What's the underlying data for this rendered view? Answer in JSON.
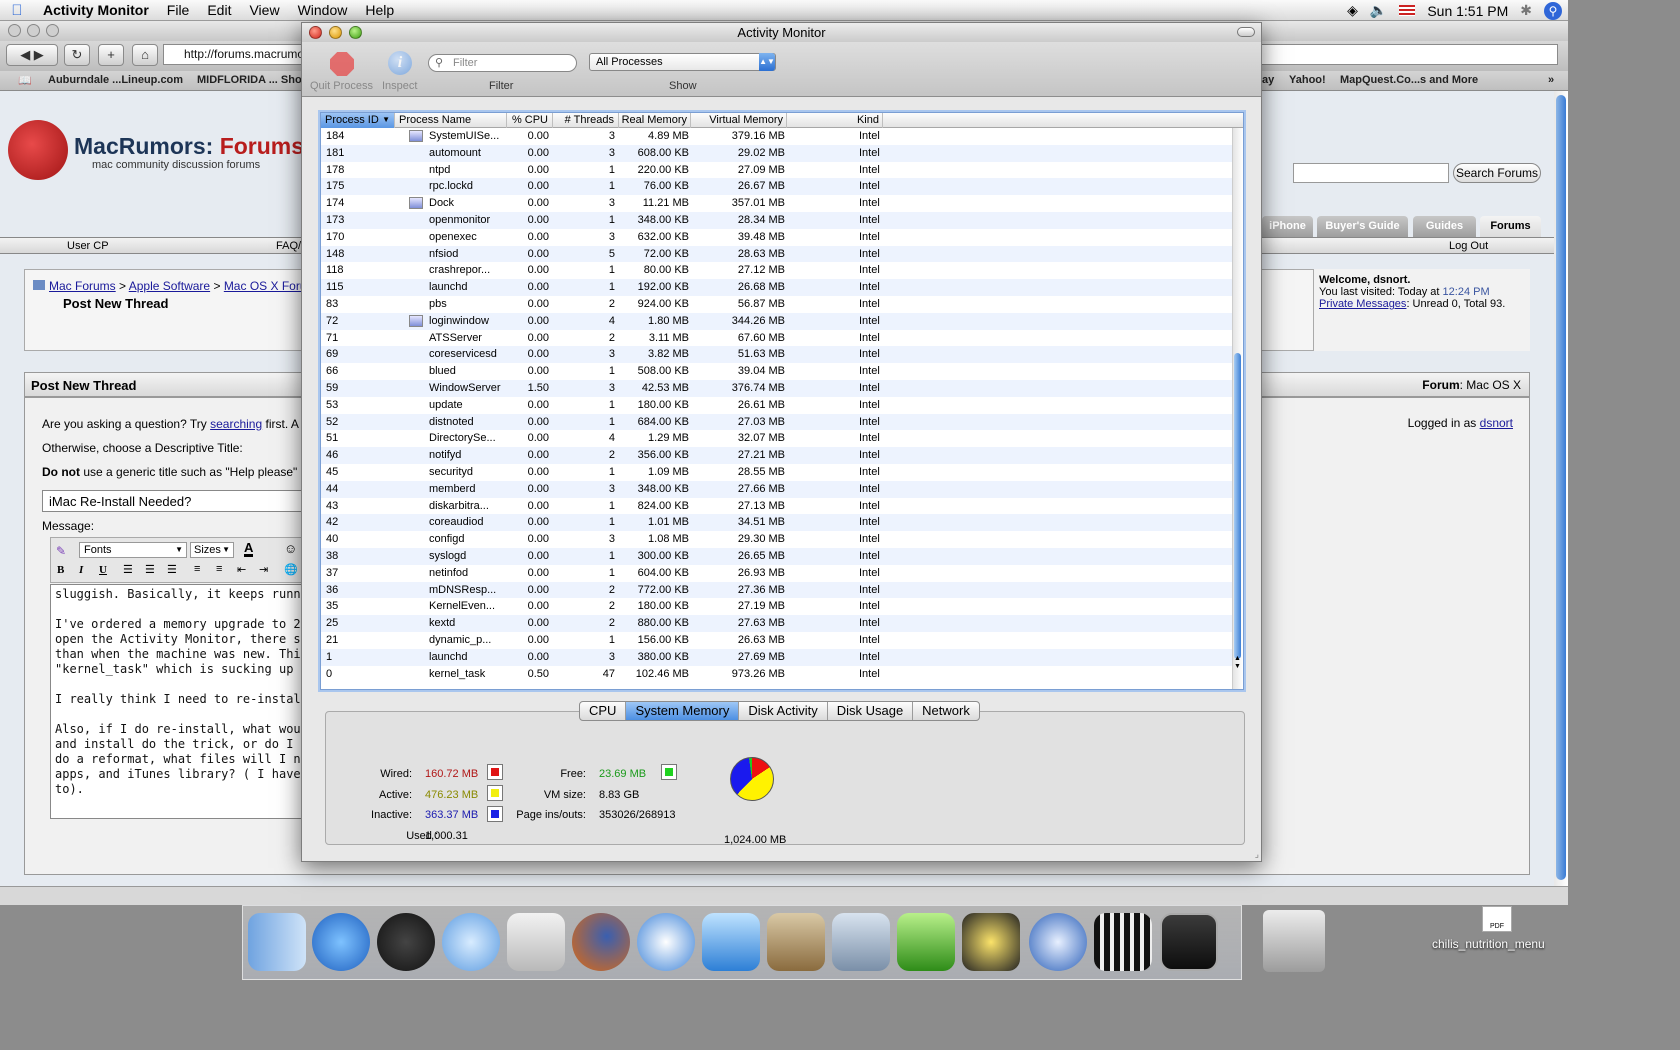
{
  "menubar": {
    "app": "Activity Monitor",
    "items": [
      "File",
      "Edit",
      "View",
      "Window",
      "Help"
    ],
    "clock": "Sun 1:51 PM"
  },
  "browser": {
    "url": "http://forums.macrumors.com/newthread.php?do=newthread&f=72",
    "bookmarks_left": [
      "Auburndale ...Lineup.com",
      "MIDFLORIDA ... Sho"
    ],
    "bookmarks_right": [
      "ay",
      "Yahoo!",
      "MapQuest.Co...s and More"
    ]
  },
  "forum": {
    "logo_main": "MacRumors:",
    "logo_forums": "Forums",
    "logo_sub": "mac community discussion forums",
    "search_button": "Search Forums",
    "tabs": [
      "iPhone",
      "Buyer's Guide",
      "Guides",
      "Forums"
    ],
    "nav_left": "User CP",
    "nav_mid": "FAQ/",
    "nav_right": "Log Out",
    "crumbs": [
      "Mac Forums",
      "Apple Software",
      "Mac OS X Foru"
    ],
    "crumb_sep": ">",
    "page_title": "Post New Thread",
    "welcome_title": "Welcome, dsnort.",
    "last_visited_prefix": "You last visited: Today at",
    "last_visited_time": "12:24 PM",
    "pm_link": "Private Messages",
    "pm_text": ": Unread 0, Total 93.",
    "post_bar_title": "Post New Thread",
    "forum_label": "Forum",
    "forum_name": ": Mac OS X",
    "logged_in_prefix": "Logged in as",
    "logged_in_user": "dsnort",
    "ask_prefix": "Are you asking a question? Try",
    "ask_link": "searching",
    "ask_suffix": "first. A",
    "otherwise": "Otherwise, choose a Descriptive Title:",
    "donot_bold": "Do not",
    "donot_rest": "use a generic title such as \"Help please\"",
    "title_value": "iMac Re-Install Needed?",
    "message_label": "Message:",
    "font_select": "Fonts",
    "size_select": "Sizes",
    "message_text": "sluggish. Basically, it keeps running ou\n\nI've ordered a memory upgrade to 2 GB\nopen the Activity Monitor, there seems\nthan when the machine was new. This i\n\"kernel_task\" which is sucking up 10%\n\nI really think I need to re-install the OS\n\nAlso, if I do re-install, what would be th\nand install do the trick, or do I need to\ndo a reformat, what files will I need to\napps, and iTunes library? ( I have a 500\nto)."
  },
  "am": {
    "title": "Activity Monitor",
    "quit_label": "Quit Process",
    "inspect_label": "Inspect",
    "filter_placeholder": "Filter",
    "filter_label": "Filter",
    "show_value": "All Processes",
    "show_label": "Show",
    "columns": [
      "Process ID",
      "Process Name",
      "% CPU",
      "# Threads",
      "Real Memory",
      "Virtual Memory",
      "Kind"
    ],
    "sort_column": "Process ID",
    "rows": [
      {
        "pid": "184",
        "name": "SystemUISe...",
        "cpu": "0.00",
        "threads": "3",
        "real": "4.89 MB",
        "virtual": "379.16 MB",
        "kind": "Intel",
        "icon": "system-ui-server-icon"
      },
      {
        "pid": "181",
        "name": "automount",
        "cpu": "0.00",
        "threads": "3",
        "real": "608.00 KB",
        "virtual": "29.02 MB",
        "kind": "Intel"
      },
      {
        "pid": "178",
        "name": "ntpd",
        "cpu": "0.00",
        "threads": "1",
        "real": "220.00 KB",
        "virtual": "27.09 MB",
        "kind": "Intel"
      },
      {
        "pid": "175",
        "name": "rpc.lockd",
        "cpu": "0.00",
        "threads": "1",
        "real": "76.00 KB",
        "virtual": "26.67 MB",
        "kind": "Intel"
      },
      {
        "pid": "174",
        "name": "Dock",
        "cpu": "0.00",
        "threads": "3",
        "real": "11.21 MB",
        "virtual": "357.01 MB",
        "kind": "Intel",
        "icon": "dock-app-icon"
      },
      {
        "pid": "173",
        "name": "openmonitor",
        "cpu": "0.00",
        "threads": "1",
        "real": "348.00 KB",
        "virtual": "28.34 MB",
        "kind": "Intel"
      },
      {
        "pid": "170",
        "name": "openexec",
        "cpu": "0.00",
        "threads": "3",
        "real": "632.00 KB",
        "virtual": "39.48 MB",
        "kind": "Intel"
      },
      {
        "pid": "148",
        "name": "nfsiod",
        "cpu": "0.00",
        "threads": "5",
        "real": "72.00 KB",
        "virtual": "28.63 MB",
        "kind": "Intel"
      },
      {
        "pid": "118",
        "name": "crashrepor...",
        "cpu": "0.00",
        "threads": "1",
        "real": "80.00 KB",
        "virtual": "27.12 MB",
        "kind": "Intel"
      },
      {
        "pid": "115",
        "name": "launchd",
        "cpu": "0.00",
        "threads": "1",
        "real": "192.00 KB",
        "virtual": "26.68 MB",
        "kind": "Intel"
      },
      {
        "pid": "83",
        "name": "pbs",
        "cpu": "0.00",
        "threads": "2",
        "real": "924.00 KB",
        "virtual": "56.87 MB",
        "kind": "Intel"
      },
      {
        "pid": "72",
        "name": "loginwindow",
        "cpu": "0.00",
        "threads": "4",
        "real": "1.80 MB",
        "virtual": "344.26 MB",
        "kind": "Intel",
        "icon": "loginwindow-icon"
      },
      {
        "pid": "71",
        "name": "ATSServer",
        "cpu": "0.00",
        "threads": "2",
        "real": "3.11 MB",
        "virtual": "67.60 MB",
        "kind": "Intel"
      },
      {
        "pid": "69",
        "name": "coreservicesd",
        "cpu": "0.00",
        "threads": "3",
        "real": "3.82 MB",
        "virtual": "51.63 MB",
        "kind": "Intel"
      },
      {
        "pid": "66",
        "name": "blued",
        "cpu": "0.00",
        "threads": "1",
        "real": "508.00 KB",
        "virtual": "39.04 MB",
        "kind": "Intel"
      },
      {
        "pid": "59",
        "name": "WindowServer",
        "cpu": "1.50",
        "threads": "3",
        "real": "42.53 MB",
        "virtual": "376.74 MB",
        "kind": "Intel"
      },
      {
        "pid": "53",
        "name": "update",
        "cpu": "0.00",
        "threads": "1",
        "real": "180.00 KB",
        "virtual": "26.61 MB",
        "kind": "Intel"
      },
      {
        "pid": "52",
        "name": "distnoted",
        "cpu": "0.00",
        "threads": "1",
        "real": "684.00 KB",
        "virtual": "27.03 MB",
        "kind": "Intel"
      },
      {
        "pid": "51",
        "name": "DirectorySe...",
        "cpu": "0.00",
        "threads": "4",
        "real": "1.29 MB",
        "virtual": "32.07 MB",
        "kind": "Intel"
      },
      {
        "pid": "46",
        "name": "notifyd",
        "cpu": "0.00",
        "threads": "2",
        "real": "356.00 KB",
        "virtual": "27.21 MB",
        "kind": "Intel"
      },
      {
        "pid": "45",
        "name": "securityd",
        "cpu": "0.00",
        "threads": "1",
        "real": "1.09 MB",
        "virtual": "28.55 MB",
        "kind": "Intel"
      },
      {
        "pid": "44",
        "name": "memberd",
        "cpu": "0.00",
        "threads": "3",
        "real": "348.00 KB",
        "virtual": "27.66 MB",
        "kind": "Intel"
      },
      {
        "pid": "43",
        "name": "diskarbitra...",
        "cpu": "0.00",
        "threads": "1",
        "real": "824.00 KB",
        "virtual": "27.13 MB",
        "kind": "Intel"
      },
      {
        "pid": "42",
        "name": "coreaudiod",
        "cpu": "0.00",
        "threads": "1",
        "real": "1.01 MB",
        "virtual": "34.51 MB",
        "kind": "Intel"
      },
      {
        "pid": "40",
        "name": "configd",
        "cpu": "0.00",
        "threads": "3",
        "real": "1.08 MB",
        "virtual": "29.30 MB",
        "kind": "Intel"
      },
      {
        "pid": "38",
        "name": "syslogd",
        "cpu": "0.00",
        "threads": "1",
        "real": "300.00 KB",
        "virtual": "26.65 MB",
        "kind": "Intel"
      },
      {
        "pid": "37",
        "name": "netinfod",
        "cpu": "0.00",
        "threads": "1",
        "real": "604.00 KB",
        "virtual": "26.93 MB",
        "kind": "Intel"
      },
      {
        "pid": "36",
        "name": "mDNSResp...",
        "cpu": "0.00",
        "threads": "2",
        "real": "772.00 KB",
        "virtual": "27.36 MB",
        "kind": "Intel"
      },
      {
        "pid": "35",
        "name": "KernelEven...",
        "cpu": "0.00",
        "threads": "2",
        "real": "180.00 KB",
        "virtual": "27.19 MB",
        "kind": "Intel"
      },
      {
        "pid": "25",
        "name": "kextd",
        "cpu": "0.00",
        "threads": "2",
        "real": "880.00 KB",
        "virtual": "27.63 MB",
        "kind": "Intel"
      },
      {
        "pid": "21",
        "name": "dynamic_p...",
        "cpu": "0.00",
        "threads": "1",
        "real": "156.00 KB",
        "virtual": "26.63 MB",
        "kind": "Intel"
      },
      {
        "pid": "1",
        "name": "launchd",
        "cpu": "0.00",
        "threads": "3",
        "real": "380.00 KB",
        "virtual": "27.69 MB",
        "kind": "Intel"
      },
      {
        "pid": "0",
        "name": "kernel_task",
        "cpu": "0.50",
        "threads": "47",
        "real": "102.46 MB",
        "virtual": "973.26 MB",
        "kind": "Intel"
      }
    ],
    "tabs": [
      "CPU",
      "System Memory",
      "Disk Activity",
      "Disk Usage",
      "Network"
    ],
    "active_tab": "System Memory",
    "memory": {
      "wired_label": "Wired:",
      "wired_value": "160.72 MB",
      "wired_color": "#e01414",
      "active_label": "Active:",
      "active_value": "476.23 MB",
      "active_color": "#f2ef10",
      "inactive_label": "Inactive:",
      "inactive_value": "363.37 MB",
      "inactive_color": "#1a22e6",
      "used_label": "Used :",
      "used_value": "1,000.31",
      "free_label": "Free:",
      "free_value": "23.69 MB",
      "free_color": "#1ed21e",
      "vm_label": "VM size:",
      "vm_value": "8.83 GB",
      "pageins_label": "Page ins/outs:",
      "pageins_value": "353026/268913",
      "total_value": "1,024.00 MB"
    }
  },
  "dock": {
    "desktop_item": "chilis_nutrition_menu",
    "pdf_badge": "PDF"
  }
}
